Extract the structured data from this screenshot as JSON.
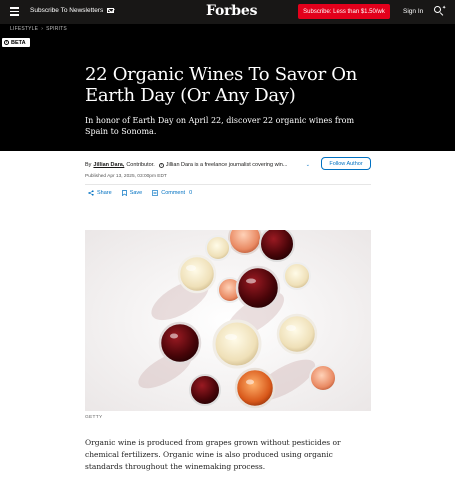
{
  "nav": {
    "subscribe_newsletters": "Subscribe To Newsletters",
    "logo": "Forbes",
    "subscribe_button": "Subscribe: Less than $1.50/wk",
    "sign_in": "Sign In"
  },
  "breadcrumb": [
    "LIFESTYLE",
    "SPIRITS"
  ],
  "beta_badge": "BETA",
  "article": {
    "headline": "22 Organic Wines To Savor On Earth Day (Or Any Day)",
    "dek": "In honor of Earth Day on April 22, discover 22 organic wines from Spain to Sonoma.",
    "byline": {
      "by": "By",
      "author": "Jillian Dara,",
      "role": "Contributor.",
      "bio": "Jillian Dara is a freelance journalist covering win...",
      "follow_label": "Follow Author"
    },
    "published": "Published Apr 13, 2025, 03:00pm EDT",
    "actions": {
      "share": "Share",
      "save": "Save",
      "comment": "Comment",
      "comment_count": "0"
    },
    "image_credit": "GETTY",
    "paragraph": "Organic wine is produced from grapes grown without pesticides or chemical fertilizers. Organic wine is also produced using organic standards throughout the winemaking process."
  },
  "icons": {
    "menu": "menu-icon",
    "mail": "mail-icon",
    "search": "search-icon",
    "info": "info-icon",
    "share": "share-icon",
    "save": "bookmark-icon",
    "comment": "comment-icon"
  },
  "colors": {
    "nav_bg": "#181716",
    "subscribe_red": "#e3001b",
    "accent_blue": "#0071c2"
  }
}
